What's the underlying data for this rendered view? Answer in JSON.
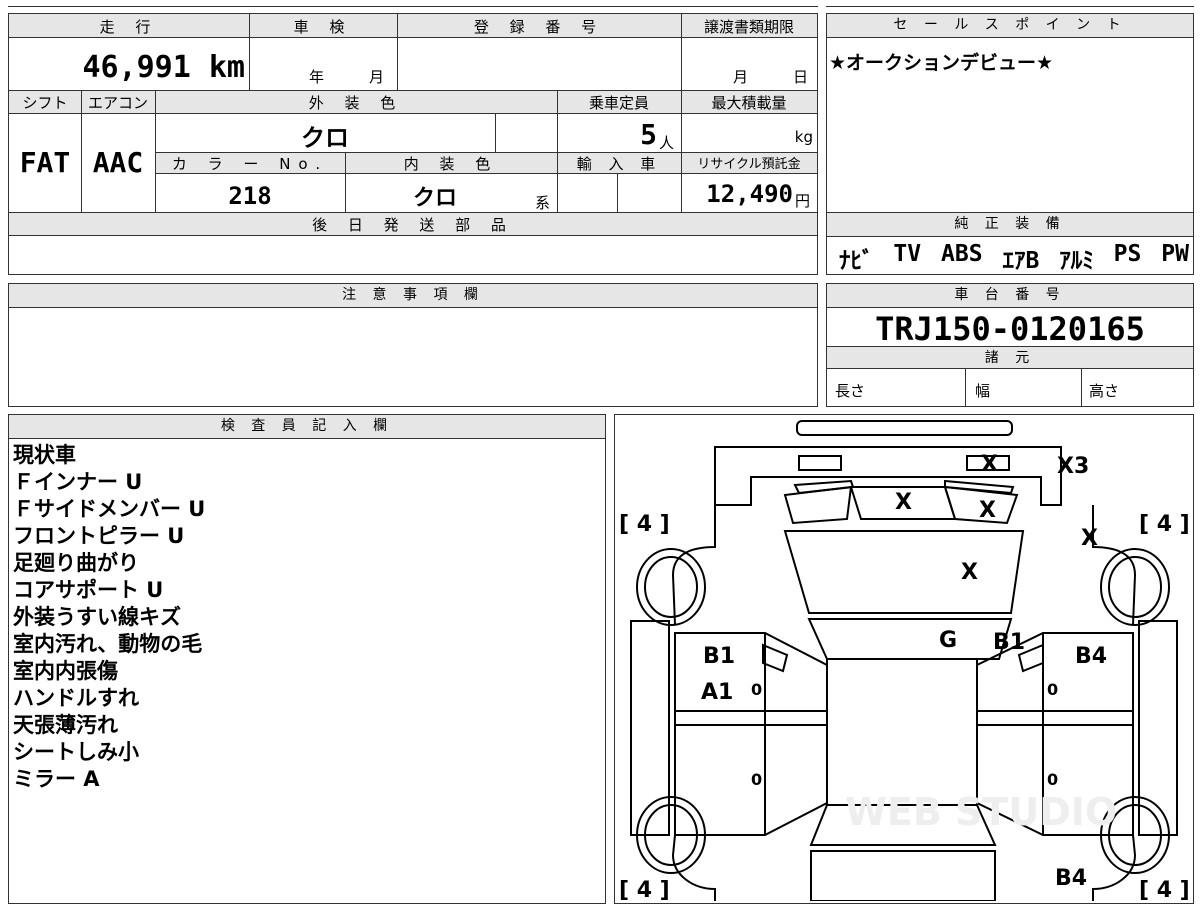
{
  "top_table": {
    "mileage_label": "走 行",
    "mileage_value": "46,991 km",
    "inspection_label": "車 検",
    "inspection_year": "年",
    "inspection_month": "月",
    "registration_label": "登 録 番 号",
    "transfer_label": "譲渡書類期限",
    "transfer_month": "月",
    "transfer_day": "日",
    "shift_label": "シフト",
    "shift_value": "FAT",
    "ac_label": "エアコン",
    "ac_value": "AAC",
    "exterior_color_label": "外 装 色",
    "exterior_color_value": "クロ",
    "capacity_label": "乗車定員",
    "capacity_value": "5",
    "capacity_unit": "人",
    "max_load_label": "最大積載量",
    "max_load_unit": "kg",
    "color_no_label": "カ ラ ー No.",
    "color_no_value": "218",
    "interior_color_label": "内 装 色",
    "interior_color_value": "クロ",
    "interior_color_suffix": "系",
    "import_label": "輸 入 車",
    "recycle_label": "リサイクル預託金",
    "recycle_value": "12,490",
    "recycle_unit": "円",
    "later_parts_label": "後 日 発 送 部 品"
  },
  "sales_point": {
    "label": "セ ー ル ス ポ イ ン ト",
    "text": "★オークションデビュー★"
  },
  "equipment": {
    "label": "純 正 装 備",
    "items": [
      "ﾅﾋﾞ",
      "TV",
      "ABS",
      "ｴｱB",
      "ｱﾙﾐ",
      "PS",
      "PW"
    ]
  },
  "notes_section": {
    "label": "注 意 事 項 欄"
  },
  "chassis": {
    "label": "車 台 番 号",
    "value": "TRJ150-0120165",
    "specs_label": "諸 元",
    "length_label": "長さ",
    "width_label": "幅",
    "height_label": "高さ"
  },
  "inspector": {
    "label": "検 査 員 記 入 欄",
    "notes": [
      "現状車",
      "Ｆインナー U",
      "Ｆサイドメンバー U",
      "フロントピラー U",
      "足廻り曲がり",
      "コアサポート U",
      "外装うすい線キズ",
      "室内汚れ、動物の毛",
      "室内内張傷",
      "ハンドルすれ",
      "天張薄汚れ",
      "シートしみ小",
      "ミラー A"
    ]
  },
  "diagram": {
    "tire_labels": [
      "[ 4 ]",
      "[ 4 ]",
      "[ 4 ]",
      "[ 4 ]"
    ],
    "marks": [
      "X",
      "X3",
      "X",
      "X",
      "X",
      "X",
      "G",
      "B1",
      "B1",
      "B4",
      "A1",
      "B4"
    ],
    "small_zeros": [
      "0",
      "0",
      "0",
      "0"
    ],
    "watermark": "WEB STUDIO"
  }
}
